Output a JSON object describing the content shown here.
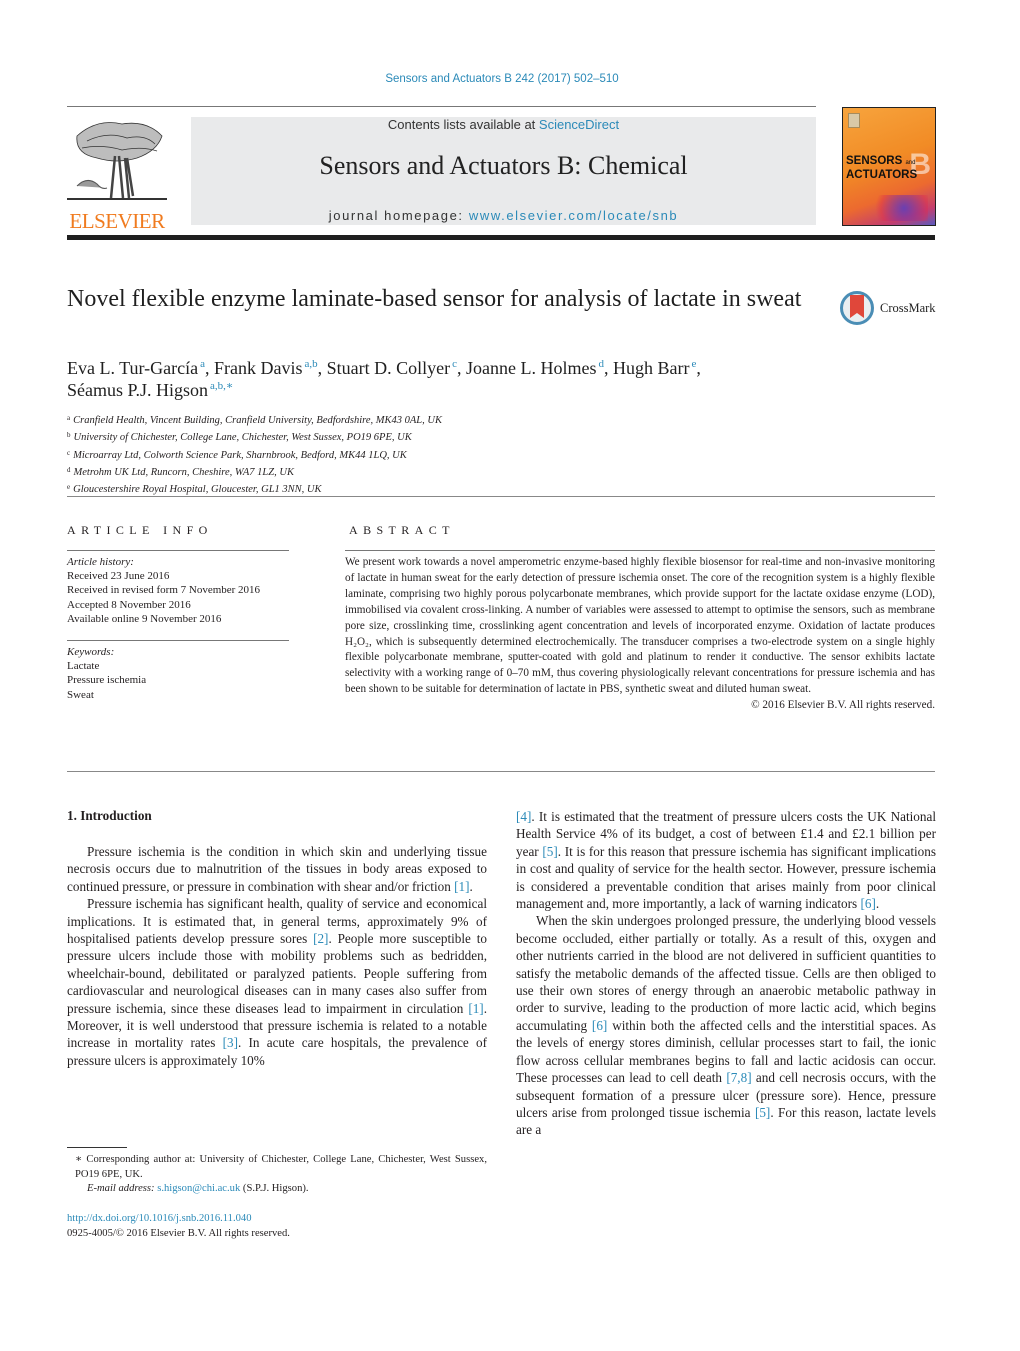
{
  "header": {
    "citation": "Sensors and Actuators B 242 (2017) 502–510",
    "publisher_logo_text": "ELSEVIER",
    "contents_prefix": "Contents lists available at ",
    "contents_link": "ScienceDirect",
    "journal_title": "Sensors and Actuators B: Chemical",
    "homepage_prefix": "journal homepage: ",
    "homepage_link": "www.elsevier.com/locate/snb",
    "cover": {
      "line1": "SENSORS",
      "and": "and",
      "line2": "ACTUATORS",
      "letter": "B"
    },
    "accent_color": "#2b8ab8",
    "logo_color": "#f07b1f"
  },
  "article": {
    "title": "Novel flexible enzyme laminate-based sensor for analysis of lactate in sweat",
    "crossmark_label": "CrossMark",
    "authors": [
      {
        "name": "Eva L. Tur-García",
        "sup": "a",
        "sep": ", "
      },
      {
        "name": "Frank Davis",
        "sup": "a,b",
        "sep": ", "
      },
      {
        "name": "Stuart D. Collyer",
        "sup": "c",
        "sep": ", "
      },
      {
        "name": "Joanne L. Holmes",
        "sup": "d",
        "sep": ", "
      },
      {
        "name": "Hugh Barr",
        "sup": "e",
        "sep": ","
      },
      {
        "name": "Séamus P.J. Higson",
        "sup": "a,b,∗",
        "sep": ""
      }
    ],
    "affiliations": [
      {
        "key": "a",
        "text": "Cranfield Health, Vincent Building, Cranfield University, Bedfordshire, MK43 0AL, UK"
      },
      {
        "key": "b",
        "text": "University of Chichester, College Lane, Chichester, West Sussex, PO19 6PE, UK"
      },
      {
        "key": "c",
        "text": "Microarray Ltd, Colworth Science Park, Sharnbrook, Bedford, MK44 1LQ, UK"
      },
      {
        "key": "d",
        "text": "Metrohm UK Ltd, Runcorn, Cheshire, WA7 1LZ, UK"
      },
      {
        "key": "e",
        "text": "Gloucestershire Royal Hospital, Gloucester, GL1 3NN, UK"
      }
    ]
  },
  "article_info": {
    "heading": "ARTICLE INFO",
    "history_label": "Article history:",
    "history": [
      "Received 23 June 2016",
      "Received in revised form 7 November 2016",
      "Accepted 8 November 2016",
      "Available online 9 November 2016"
    ],
    "keywords_label": "Keywords:",
    "keywords": [
      "Lactate",
      "Pressure ischemia",
      "Sweat"
    ]
  },
  "abstract": {
    "heading": "ABSTRACT",
    "text_before_formula": "We present work towards a novel amperometric enzyme-based highly flexible biosensor for real-time and non-invasive monitoring of lactate in human sweat for the early detection of pressure ischemia onset. The core of the recognition system is a highly flexible laminate, comprising two highly porous polycarbonate membranes, which provide support for the lactate oxidase enzyme (LOD), immobilised via covalent cross-linking. A number of variables were assessed to attempt to optimise the sensors, such as membrane pore size, crosslinking time, crosslinking agent concentration and levels of incorporated enzyme. Oxidation of lactate produces ",
    "formula": "H₂O₂",
    "text_after_formula": ", which is subsequently determined electrochemically. The transducer comprises a two-electrode system on a single highly flexible polycarbonate membrane, sputter-coated with gold and platinum to render it conductive. The sensor exhibits lactate selectivity with a working range of 0–70 mM, thus covering physiologically relevant concentrations for pressure ischemia and has been shown to be suitable for determination of lactate in PBS, synthetic sweat and diluted human sweat.",
    "copyright": "© 2016 Elsevier B.V. All rights reserved."
  },
  "body": {
    "section_heading": "1.  Introduction",
    "left_column": {
      "p1": [
        {
          "t": "Pressure ischemia is the condition in which skin and underlying tissue necrosis occurs due to malnutrition of the tissues in body areas exposed to continued pressure, or pressure in combination with shear and/or friction "
        },
        {
          "ref": "[1]"
        },
        {
          "t": "."
        }
      ],
      "p2": [
        {
          "t": "Pressure ischemia has significant health, quality of service and economical implications. It is estimated that, in general terms, approximately 9% of hospitalised patients develop pressure sores "
        },
        {
          "ref": "[2]"
        },
        {
          "t": ". People more susceptible to pressure ulcers include those with mobility problems such as bedridden, wheelchair-bound, debilitated or paralyzed patients. People suffering from cardiovascular and neurological diseases can in many cases also suffer from pressure ischemia, since these diseases lead to impairment in circulation "
        },
        {
          "ref": "[1]"
        },
        {
          "t": ". Moreover, it is well understood that pressure ischemia is related to a notable increase in mortality rates "
        },
        {
          "ref": "[3]"
        },
        {
          "t": ". In acute care hospitals, the prevalence of pressure ulcers is approximately 10%"
        }
      ]
    },
    "right_column": {
      "p1": [
        {
          "ref": "[4]"
        },
        {
          "t": ". It is estimated that the treatment of pressure ulcers costs the UK National Health Service 4% of its budget, a cost of between £1.4 and £2.1 billion per year "
        },
        {
          "ref": "[5]"
        },
        {
          "t": ". It is for this reason that pressure ischemia has significant implications in cost and quality of service for the health sector. However, pressure ischemia is considered a preventable condition that arises mainly from poor clinical management and, more importantly, a lack of warning indicators "
        },
        {
          "ref": "[6]"
        },
        {
          "t": "."
        }
      ],
      "p2": [
        {
          "t": "When the skin undergoes prolonged pressure, the underlying blood vessels become occluded, either partially or totally. As a result of this, oxygen and other nutrients carried in the blood are not delivered in sufficient quantities to satisfy the metabolic demands of the affected tissue. Cells are then obliged to use their own stores of energy through an anaerobic metabolic pathway in order to survive, leading to the production of more lactic acid, which begins accumulating "
        },
        {
          "ref": "[6]"
        },
        {
          "t": " within both the affected cells and the interstitial spaces. As the levels of energy stores diminish, cellular processes start to fail, the ionic flow across cellular membranes begins to fall and lactic acidosis can occur. These processes can lead to cell death "
        },
        {
          "ref": "[7,8]"
        },
        {
          "t": " and cell necrosis occurs, with the subsequent formation of a pressure ulcer (pressure sore). Hence, pressure ulcers arise from prolonged tissue ischemia "
        },
        {
          "ref": "[5]"
        },
        {
          "t": ". For this reason, lactate levels are a"
        }
      ]
    }
  },
  "footnotes": {
    "corresponding": "∗  Corresponding author at: University of Chichester, College Lane, Chichester, West Sussex, PO19 6PE, UK.",
    "email_label": "E-mail address:",
    "email": "s.higson@chi.ac.uk",
    "email_suffix": " (S.P.J. Higson).",
    "doi": "http://dx.doi.org/10.1016/j.snb.2016.11.040",
    "issn_copyright": "0925-4005/© 2016 Elsevier B.V. All rights reserved."
  }
}
